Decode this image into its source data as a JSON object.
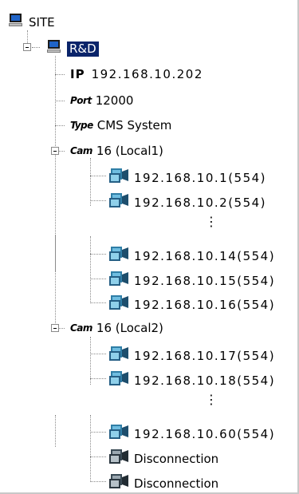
{
  "tree": {
    "root": {
      "label": "SITE",
      "icon": "computer-icon"
    },
    "site": {
      "label": "R&D",
      "icon": "computer-icon",
      "ip_label": "IP",
      "ip_value": "192.168.10.202",
      "port_label": "Port",
      "port_value": "12000",
      "type_label": "Type",
      "type_value": "CMS System",
      "groups": [
        {
          "label": "Cam",
          "value": "16 (Local1)",
          "cameras_top": [
            "192.168.10.1(554)",
            "192.168.10.2(554)"
          ],
          "cameras_bottom": [
            "192.168.10.14(554)",
            "192.168.10.15(554)",
            "192.168.10.16(554)"
          ]
        },
        {
          "label": "Cam",
          "value": "16 (Local2)",
          "cameras_top": [
            "192.168.10.17(554)",
            "192.168.10.18(554)"
          ],
          "cameras_bottom": [
            "192.168.10.60(554)",
            "Disconnection",
            "Disconnection"
          ]
        }
      ]
    },
    "ellipsis": "⋮",
    "camera_icon": "camera-icon",
    "expand_icon": "minus-expander-icon"
  }
}
